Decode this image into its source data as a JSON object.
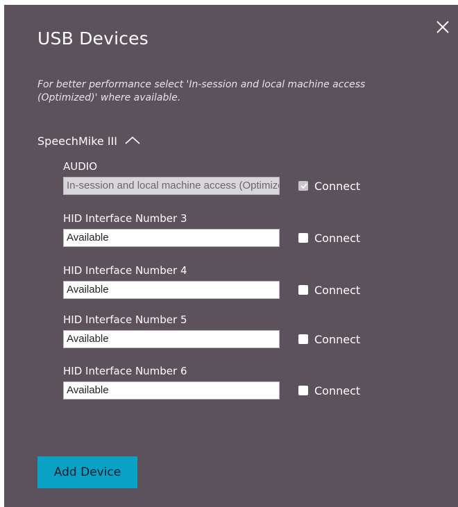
{
  "dialog": {
    "title": "USB Devices",
    "hint": "For better performance select 'In-session and local machine access (Optimized)' where available.",
    "close_icon": "close-icon"
  },
  "device": {
    "name": "SpeechMike III",
    "expanded": true,
    "interfaces": [
      {
        "label": "AUDIO",
        "mode": "In-session and local machine access (Optimized)",
        "mode_disabled": true,
        "connect_label": "Connect",
        "connected": true,
        "connect_disabled": true
      },
      {
        "label": "HID Interface Number 3",
        "mode": "Available",
        "mode_disabled": false,
        "connect_label": "Connect",
        "connected": false,
        "connect_disabled": false
      },
      {
        "label": "HID Interface Number 4",
        "mode": "Available",
        "mode_disabled": false,
        "connect_label": "Connect",
        "connected": false,
        "connect_disabled": false
      },
      {
        "label": "HID Interface Number 5",
        "mode": "Available",
        "mode_disabled": false,
        "connect_label": "Connect",
        "connected": false,
        "connect_disabled": false
      },
      {
        "label": "HID Interface Number 6",
        "mode": "Available",
        "mode_disabled": false,
        "connect_label": "Connect",
        "connected": false,
        "connect_disabled": false
      }
    ]
  },
  "footer": {
    "add_device_label": "Add Device"
  },
  "colors": {
    "panel_bg": "#5b525b",
    "accent_button": "#0aa1c7",
    "text": "#ffffff"
  }
}
